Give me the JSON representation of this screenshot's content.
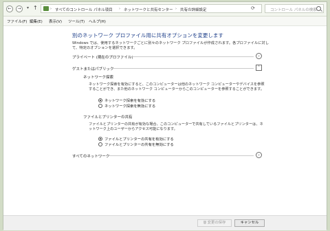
{
  "addressbar": {
    "path": [
      "すべてのコントロール パネル項目",
      "ネットワークと共有センター",
      "共有の詳細設定"
    ],
    "search_placeholder": "コントロール パネルの検索"
  },
  "menu": [
    "ファイル(F)",
    "編集(E)",
    "表示(V)",
    "ツール(T)",
    "ヘルプ(H)"
  ],
  "content": {
    "heading": "別のネットワーク プロファイル用に共有オプションを変更します",
    "description": "Windows では、使用するネットワークごとに別々のネットワーク プロファイルが作成されます。各プロファイルに対して、特定のオプションを選択できます。",
    "sections": {
      "private": "プライベート (現在のプロファイル)",
      "guest": "ゲストまたはパブリック",
      "all": "すべてのネットワーク"
    },
    "discovery": {
      "title": "ネットワーク探索",
      "text": "ネットワーク探索を有効にすると、このコンピューターは他のネットワーク コンピューターやデバイスを参照することができ、また他のネットワーク コンピューターからこのコンピューターを参照することができます。",
      "options": [
        "ネットワーク探索を有効にする",
        "ネットワーク探索を無効にする"
      ],
      "selected_index": 0
    },
    "sharing": {
      "title": "ファイルとプリンターの共有",
      "text": "ファイルとプリンターの共有が有効な場合、このコンピューターで共有しているファイルとプリンターは、ネットワーク上のユーザーからアクセス可能になります。",
      "options": [
        "ファイルとプリンターの共有を有効にする",
        "ファイルとプリンターの共有を無効にする"
      ],
      "selected_index": 0
    }
  },
  "footer": {
    "save_label": "変更の保存",
    "cancel_label": "キャンセル"
  }
}
